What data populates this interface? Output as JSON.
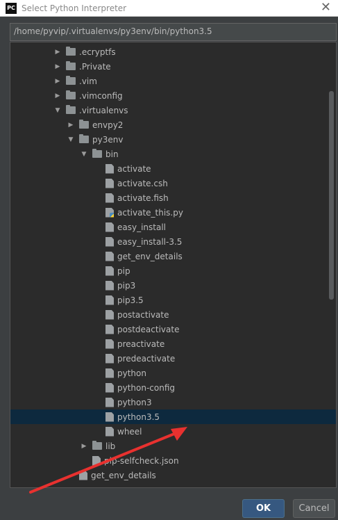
{
  "window": {
    "title": "Select Python Interpreter",
    "icon_text": "PC"
  },
  "path_field": {
    "value": "/home/pyvip/.virtualenvs/py3env/bin/python3.5"
  },
  "tree": [
    {
      "label": ".ecryptfs",
      "type": "folder",
      "expanded": false,
      "depth": 0,
      "name": "tree-item-ecryptfs"
    },
    {
      "label": ".Private",
      "type": "folder",
      "expanded": false,
      "depth": 0,
      "name": "tree-item-private"
    },
    {
      "label": ".vim",
      "type": "folder",
      "expanded": false,
      "depth": 0,
      "name": "tree-item-vim"
    },
    {
      "label": ".vimconfig",
      "type": "folder",
      "expanded": false,
      "depth": 0,
      "name": "tree-item-vimconfig"
    },
    {
      "label": ".virtualenvs",
      "type": "folder",
      "expanded": true,
      "depth": 0,
      "name": "tree-item-virtualenvs"
    },
    {
      "label": "envpy2",
      "type": "folder",
      "expanded": false,
      "depth": 1,
      "name": "tree-item-envpy2"
    },
    {
      "label": "py3env",
      "type": "folder",
      "expanded": true,
      "depth": 1,
      "name": "tree-item-py3env"
    },
    {
      "label": "bin",
      "type": "folder",
      "expanded": true,
      "depth": 2,
      "name": "tree-item-bin"
    },
    {
      "label": "activate",
      "type": "file",
      "depth": 3,
      "name": "tree-item-activate"
    },
    {
      "label": "activate.csh",
      "type": "file",
      "depth": 3,
      "name": "tree-item-activate-csh"
    },
    {
      "label": "activate.fish",
      "type": "file",
      "depth": 3,
      "name": "tree-item-activate-fish"
    },
    {
      "label": "activate_this.py",
      "type": "pyfile",
      "depth": 3,
      "name": "tree-item-activate-this-py"
    },
    {
      "label": "easy_install",
      "type": "file",
      "depth": 3,
      "name": "tree-item-easy-install"
    },
    {
      "label": "easy_install-3.5",
      "type": "file",
      "depth": 3,
      "name": "tree-item-easy-install-35"
    },
    {
      "label": "get_env_details",
      "type": "file",
      "depth": 3,
      "name": "tree-item-get-env-details"
    },
    {
      "label": "pip",
      "type": "file",
      "depth": 3,
      "name": "tree-item-pip"
    },
    {
      "label": "pip3",
      "type": "file",
      "depth": 3,
      "name": "tree-item-pip3"
    },
    {
      "label": "pip3.5",
      "type": "file",
      "depth": 3,
      "name": "tree-item-pip35"
    },
    {
      "label": "postactivate",
      "type": "file",
      "depth": 3,
      "name": "tree-item-postactivate"
    },
    {
      "label": "postdeactivate",
      "type": "file",
      "depth": 3,
      "name": "tree-item-postdeactivate"
    },
    {
      "label": "preactivate",
      "type": "file",
      "depth": 3,
      "name": "tree-item-preactivate"
    },
    {
      "label": "predeactivate",
      "type": "file",
      "depth": 3,
      "name": "tree-item-predeactivate"
    },
    {
      "label": "python",
      "type": "file",
      "depth": 3,
      "name": "tree-item-python"
    },
    {
      "label": "python-config",
      "type": "file",
      "depth": 3,
      "name": "tree-item-python-config"
    },
    {
      "label": "python3",
      "type": "file",
      "depth": 3,
      "name": "tree-item-python3"
    },
    {
      "label": "python3.5",
      "type": "file",
      "depth": 3,
      "selected": true,
      "name": "tree-item-python35"
    },
    {
      "label": "wheel",
      "type": "file",
      "depth": 3,
      "name": "tree-item-wheel"
    },
    {
      "label": "lib",
      "type": "folder",
      "expanded": false,
      "depth": 2,
      "name": "tree-item-lib"
    },
    {
      "label": "pip-selfcheck.json",
      "type": "file",
      "depth": 2,
      "name": "tree-item-pip-selfcheck-json"
    },
    {
      "label": "get_env_details",
      "type": "file",
      "depth": 1,
      "name": "tree-item-get-env-details-2"
    }
  ],
  "buttons": {
    "ok": "OK",
    "cancel": "Cancel"
  },
  "colors": {
    "selection": "#0d293e",
    "annotation_arrow": "#e8312f"
  }
}
